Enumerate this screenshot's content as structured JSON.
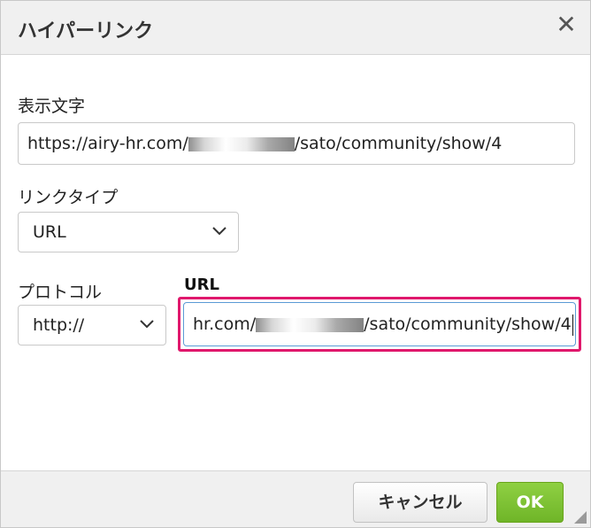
{
  "dialog": {
    "title": "ハイパーリンク",
    "close_glyph": "✕"
  },
  "display_text": {
    "label": "表示文字",
    "value_prefix": "https://airy-hr.com/",
    "value_suffix": "/sato/community/show/4"
  },
  "link_type": {
    "label": "リンクタイプ",
    "selected": "URL"
  },
  "protocol": {
    "label": "プロトコル",
    "selected": "http://"
  },
  "url": {
    "label": "URL",
    "value_prefix": "hr.com/",
    "value_suffix": "/sato/community/show/4"
  },
  "footer": {
    "cancel_label": "キャンセル",
    "ok_label": "OK"
  },
  "colors": {
    "highlight": "#e0186c",
    "ok_green": "#7cc332"
  },
  "icons": {
    "close": "close-icon",
    "chevron": "chevron-down-icon",
    "resize": "resize-grip-icon"
  }
}
